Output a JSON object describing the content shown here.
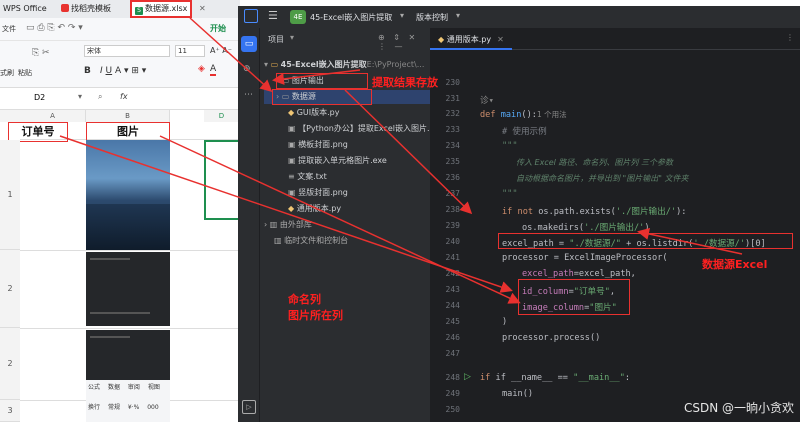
{
  "wps": {
    "tabs": [
      "WPS Office",
      "找稻壳模板",
      "数据源.xlsx"
    ],
    "ribbon": {
      "start": "开始",
      "font_name": "宋体",
      "font_size": "11",
      "file": "文件",
      "format": "式刷",
      "paste": "粘贴",
      "bold": "B"
    },
    "cell_ref": "D2",
    "fx": "fx",
    "col_a": "A",
    "col_b": "B",
    "col_d": "D",
    "header_id": "订单号",
    "header_img": "图片",
    "rows": [
      "1",
      "2",
      "2",
      "3"
    ],
    "embedded_toolbar": [
      "公式",
      "数据",
      "审阅",
      "视图"
    ],
    "embedded_toolbar2": [
      "换行",
      "常规",
      "¥·%",
      "000"
    ]
  },
  "ide": {
    "project_badge": "4E",
    "project_name": "45-Excel嵌入图片提取",
    "vcs": "版本控制",
    "panel_title": "项目",
    "root": "45-Excel嵌入图片提取",
    "root_path": "E:\\PyProject\\...",
    "files": [
      "图片输出",
      "数据源",
      "GUI版本.py",
      "【Python办公】提取Excel嵌入图片...",
      "横板封面.png",
      "提取嵌入单元格图片.exe",
      "文案.txt",
      "竖版封面.png",
      "通用版本.py"
    ],
    "extra": [
      "由外部库",
      "临时文件和控制台"
    ],
    "tab": "通用版本.py",
    "usages": "1 个用法",
    "lines": [
      "230",
      "231",
      "232",
      "233",
      "234",
      "235",
      "236",
      "237",
      "238",
      "239",
      "240",
      "241",
      "242",
      "243",
      "244",
      "245",
      "246",
      "247",
      "248",
      "249",
      "250"
    ],
    "code": {
      "def": "def ",
      "main": "main",
      "paren": "():",
      "cm_usage": "# 使用示例",
      "doc_q": "\"\"\"",
      "doc1": "传入 Excel 路径、命名列、图片列 三个参数",
      "doc2": "自动根据命名图片，并导出到 \"图片输出\" 文件夹",
      "if": "if ",
      "not": "not ",
      "os_exists": "os.path.exists(",
      "st_out": "'./图片输出/'",
      "close": "):",
      "mkdirs": "os.makedirs(",
      "close2": ")",
      "excel_path": "excel_path = ",
      "st_src": "\"./数据源/\"",
      "plus": " + os.listdir(",
      "st_src2": "'./数据源/'",
      "idx": ")[0]",
      "processor": "processor = ExcelImageProcessor(",
      "pm_excel": "excel_path",
      "eq_excel": "=excel_path,",
      "pm_id": "id_column",
      "st_id": "\"订单号\"",
      "comma": ",",
      "pm_img": "image_column",
      "st_img": "\"图片\"",
      "rparen": ")",
      "process": "processor.process()",
      "if_main": "if __name__ == ",
      "st_main": "\"__main__\"",
      "colon": ":",
      "main_call": "main()"
    }
  },
  "annotations": {
    "save": "提取结果存放",
    "source": "数据源Excel",
    "name_col": "命名列",
    "img_col": "图片所在列"
  },
  "watermark": "CSDN @一晌小贪欢"
}
